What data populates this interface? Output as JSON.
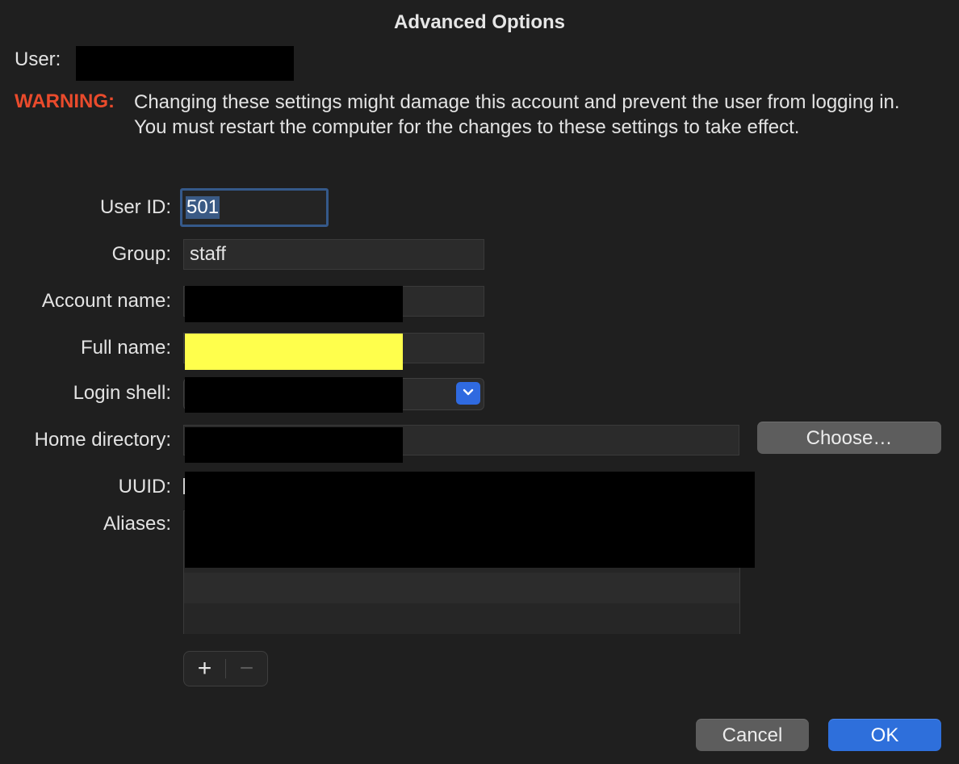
{
  "dialog": {
    "title": "Advanced Options"
  },
  "user": {
    "label": "User:"
  },
  "warning": {
    "label": "WARNING:",
    "text": "Changing these settings might damage this account and prevent the user from logging in. You must restart the computer for the changes to these settings to take effect.",
    "color": "#ea4b2c"
  },
  "fields": {
    "user_id": {
      "label": "User ID:",
      "value": "501"
    },
    "group": {
      "label": "Group:",
      "value": "staff"
    },
    "account_name": {
      "label": "Account name:",
      "value": ""
    },
    "full_name": {
      "label": "Full name:",
      "value": ""
    },
    "login_shell": {
      "label": "Login shell:",
      "value": ""
    },
    "home_directory": {
      "label": "Home directory:",
      "value": ""
    },
    "uuid": {
      "label": "UUID:",
      "value": ""
    },
    "aliases": {
      "label": "Aliases:"
    }
  },
  "buttons": {
    "choose": "Choose…",
    "cancel": "Cancel",
    "ok": "OK",
    "add": "+",
    "remove": "−"
  },
  "colors": {
    "accent": "#2e6fdb",
    "redaction": "#000000",
    "highlight": "#ffff4c"
  }
}
